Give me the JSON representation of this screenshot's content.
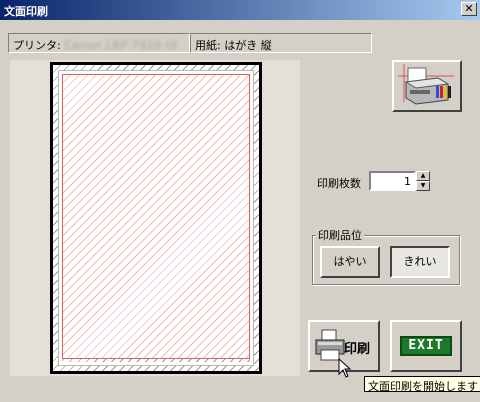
{
  "window": {
    "title": "文面印刷",
    "close_glyph": "✕"
  },
  "status": {
    "printer_label": "プリンタ:",
    "printer_name": "Canon LBP-7010 Ul",
    "paper_text": "用紙: はがき 縦"
  },
  "copies": {
    "label": "印刷枚数",
    "value": "1"
  },
  "quality": {
    "legend": "印刷品位",
    "fast_label": "はやい",
    "fine_label": "きれい"
  },
  "buttons": {
    "print_label": "印刷",
    "exit_label": "EXIT"
  },
  "tooltip": {
    "text": "文面印刷を開始します"
  }
}
